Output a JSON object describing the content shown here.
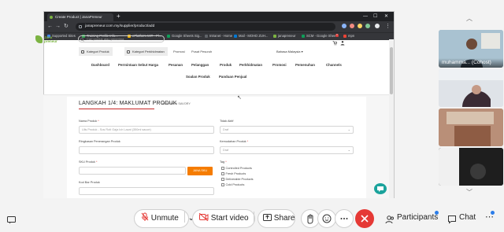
{
  "browser": {
    "tab_title": "Create Product | JanaPreneur",
    "url": "janapreneur.com.my/supplier/product/add",
    "bookmarks": [
      {
        "label": "Supported Sites",
        "color": "#4285f4"
      },
      {
        "label": "Training Profile Info...",
        "color": "#34a853"
      },
      {
        "label": "ePlatform MIT - Pl...",
        "color": "#fbbc05"
      },
      {
        "label": "Google Sheets Sig...",
        "color": "#0f9d58"
      },
      {
        "label": "Intranet - Home",
        "color": "#5f6368"
      },
      {
        "label": "Mail - MOHD ZUH...",
        "color": "#0078d4"
      },
      {
        "label": "janapreneur",
        "color": "#7cb342"
      },
      {
        "label": "SCM - Google Sheets",
        "color": "#0f9d58"
      },
      {
        "label": "mpn",
        "color": "#ea4335"
      }
    ]
  },
  "site": {
    "logo": "Jana preneur",
    "search_placeholder": "Cari produk atau penerima",
    "cart_badge": "0",
    "category_product": "Kategori Produk",
    "category_service": "Kategori Perkhidmatan",
    "links": [
      "Promosi",
      "Pusat Pesuruh"
    ],
    "language": "Bahasa Malaysia",
    "menu_row1": [
      "Dashboard",
      "Permintaan Sebut Harga",
      "Pesanan",
      "Pelanggan",
      "Produk",
      "Perkhidmatan",
      "Promosi",
      "Pemenuhan",
      "Channels"
    ],
    "menu_row2": [
      "Soalan Produk",
      "Panduan Penjual"
    ]
  },
  "form": {
    "title": "LANGKAH 1/4: MAKLUMAT PRODUK",
    "subtitle": "KEMPAKNI SAVORY",
    "product_name_label": "Nama Produk",
    "product_name_placeholder": "Ulis Produk - Sos Roti Gaja Ich Lazat (350ml sauce)",
    "short_desc_label": "Ringkasan Penerangan Produk",
    "sku_label": "SKU Produk",
    "sku_button": "JANA SKU",
    "extra_label": "Kod Bar Produk",
    "status_label": "Tidak Aktif",
    "status_value": "Draf",
    "category_label": "Kemudahan Produk",
    "category_value": "Draf",
    "tags_label": "Tag",
    "tags": [
      "Controlled Products",
      "Fresh Products",
      "Deliverable Products",
      "Cold Products"
    ]
  },
  "meeting": {
    "participants": [
      {
        "name": "muhamma... (Cohost)",
        "bg": "#9fb7c6"
      },
      {
        "name": "",
        "bg": "#d8dde3"
      },
      {
        "name": "",
        "bg": "#c9a08a"
      },
      {
        "name": "",
        "bg": "#2d2d2d"
      }
    ],
    "unmute_label": "Unmute",
    "start_video_label": "Start video",
    "share_label": "Share",
    "participants_label": "Participants",
    "chat_label": "Chat"
  }
}
